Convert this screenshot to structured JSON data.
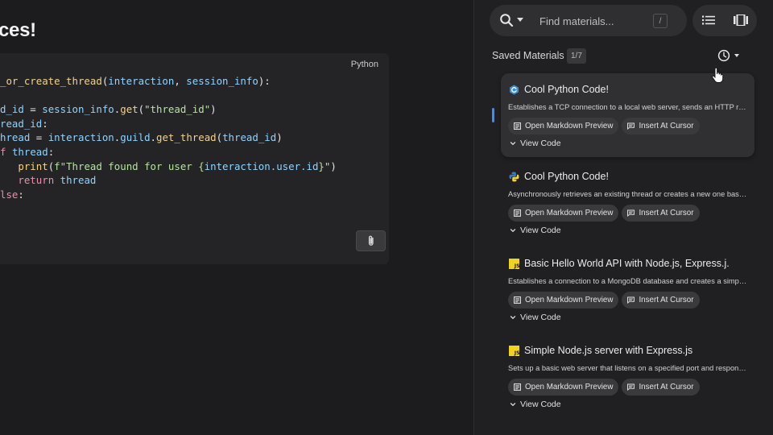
{
  "left": {
    "heading": "ces!",
    "code_block": {
      "language": "Python",
      "lines": [
        [
          {
            "t": "_or_create_thread",
            "c": "tok-fn"
          },
          {
            "t": "(",
            "c": "tok-plain"
          },
          {
            "t": "interaction",
            "c": "tok-var"
          },
          {
            "t": ", ",
            "c": "tok-plain"
          },
          {
            "t": "session_info",
            "c": "tok-var"
          },
          {
            "t": "):",
            "c": "tok-plain"
          }
        ],
        [],
        [
          {
            "t": "d_id",
            "c": "tok-var"
          },
          {
            "t": " = ",
            "c": "tok-plain"
          },
          {
            "t": "session_info",
            "c": "tok-var"
          },
          {
            "t": ".",
            "c": "tok-plain"
          },
          {
            "t": "get",
            "c": "tok-fn"
          },
          {
            "t": "(",
            "c": "tok-plain"
          },
          {
            "t": "\"thread_id\"",
            "c": "tok-str"
          },
          {
            "t": ")",
            "c": "tok-plain"
          }
        ],
        [
          {
            "t": "read_id",
            "c": "tok-var"
          },
          {
            "t": ":",
            "c": "tok-plain"
          }
        ],
        [
          {
            "t": "hread",
            "c": "tok-var"
          },
          {
            "t": " = ",
            "c": "tok-plain"
          },
          {
            "t": "interaction",
            "c": "tok-var"
          },
          {
            "t": ".",
            "c": "tok-plain"
          },
          {
            "t": "guild",
            "c": "tok-var"
          },
          {
            "t": ".",
            "c": "tok-plain"
          },
          {
            "t": "get_thread",
            "c": "tok-fn"
          },
          {
            "t": "(",
            "c": "tok-plain"
          },
          {
            "t": "thread_id",
            "c": "tok-var"
          },
          {
            "t": ")",
            "c": "tok-plain"
          }
        ],
        [
          {
            "t": "f",
            "c": "tok-kw"
          },
          {
            "t": " ",
            "c": "tok-plain"
          },
          {
            "t": "thread",
            "c": "tok-var"
          },
          {
            "t": ":",
            "c": "tok-plain"
          }
        ],
        [
          {
            "t": "   ",
            "c": "tok-plain"
          },
          {
            "t": "print",
            "c": "tok-fn"
          },
          {
            "t": "(",
            "c": "tok-plain"
          },
          {
            "t": "f\"Thread found for user {",
            "c": "tok-str"
          },
          {
            "t": "interaction.user.id",
            "c": "tok-var"
          },
          {
            "t": "}\"",
            "c": "tok-str"
          },
          {
            "t": ")",
            "c": "tok-plain"
          }
        ],
        [
          {
            "t": "   ",
            "c": "tok-plain"
          },
          {
            "t": "return",
            "c": "tok-kw"
          },
          {
            "t": " ",
            "c": "tok-plain"
          },
          {
            "t": "thread",
            "c": "tok-var"
          }
        ],
        [
          {
            "t": "lse",
            "c": "tok-kw"
          },
          {
            "t": ":",
            "c": "tok-plain"
          }
        ]
      ],
      "copy_button_icon": "paperclip-icon"
    }
  },
  "right": {
    "search": {
      "icon": "search-icon",
      "placeholder": "Find materials...",
      "shortcut": "/"
    },
    "view_toggle": {
      "list_icon": "list-view-icon",
      "carousel_icon": "carousel-view-icon"
    },
    "saved_label": "Saved Materials",
    "saved_count": "1/7",
    "sort_icon": "clock-icon",
    "cards": [
      {
        "icon": "cpp-icon",
        "title": "Cool Python Code!",
        "description": "Establishes a TCP connection to a local web server, sends an HTTP request, and prints the response",
        "preview_label": "Open Markdown Preview",
        "insert_label": "Insert At Cursor",
        "view_code_label": "View Code",
        "active": true
      },
      {
        "icon": "python-icon",
        "title": "Cool Python Code!",
        "description": "Asynchronously retrieves an existing thread or creates a new one based on session info",
        "preview_label": "Open Markdown Preview",
        "insert_label": "Insert At Cursor",
        "view_code_label": "View Code",
        "active": false
      },
      {
        "icon": "javascript-icon",
        "title": "Basic Hello World API with Node.js, Express.j...",
        "description": "Establishes a connection to a MongoDB database and creates a simple API endpoint",
        "preview_label": "Open Markdown Preview",
        "insert_label": "Insert At Cursor",
        "view_code_label": "View Code",
        "active": false
      },
      {
        "icon": "javascript-icon",
        "title": "Simple Node.js server with Express.js",
        "description": "Sets up a basic web server that listens on a specified port and responds to requests",
        "preview_label": "Open Markdown Preview",
        "insert_label": "Insert At Cursor",
        "view_code_label": "View Code",
        "active": false
      }
    ]
  }
}
